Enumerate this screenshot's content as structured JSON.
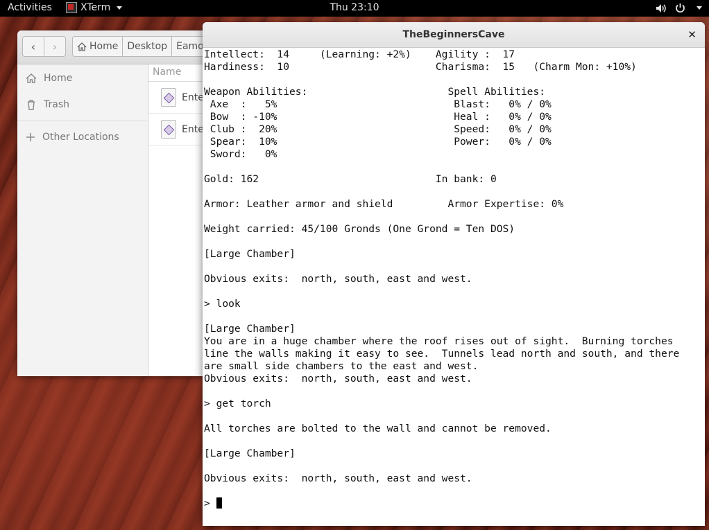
{
  "topbar": {
    "activities": "Activities",
    "app_name": "XTerm",
    "clock": "Thu 23:10"
  },
  "files": {
    "breadcrumbs": [
      "Home",
      "Desktop",
      "Eamon"
    ],
    "sidebar": [
      {
        "label": "Home",
        "icon": "home-icon"
      },
      {
        "label": "Trash",
        "icon": "trash-icon"
      },
      {
        "label": "Other Locations",
        "icon": "plus-icon"
      }
    ],
    "column_name": "Name",
    "rows": [
      {
        "label": "Ente"
      },
      {
        "label": "Ente"
      }
    ]
  },
  "terminal": {
    "title": "TheBeginnersCave",
    "lines": [
      "Intellect:  14     (Learning: +2%)    Agility :  17",
      "Hardiness:  10                        Charisma:  15   (Charm Mon: +10%)",
      "",
      "Weapon Abilities:                       Spell Abilities:",
      " Axe  :   5%                             Blast:   0% / 0%",
      " Bow  : -10%                             Heal :   0% / 0%",
      " Club :  20%                             Speed:   0% / 0%",
      " Spear:  10%                             Power:   0% / 0%",
      " Sword:   0%",
      "",
      "Gold: 162                             In bank: 0",
      "",
      "Armor: Leather armor and shield         Armor Expertise: 0%",
      "",
      "Weight carried: 45/100 Gronds (One Grond = Ten DOS)",
      "",
      "[Large Chamber]",
      "",
      "Obvious exits:  north, south, east and west.",
      "",
      "> look",
      "",
      "[Large Chamber]",
      "You are in a huge chamber where the roof rises out of sight.  Burning torches",
      "line the walls making it easy to see.  Tunnels lead north and south, and there",
      "are small side chambers to the east and west.",
      "Obvious exits:  north, south, east and west.",
      "",
      "> get torch",
      "",
      "All torches are bolted to the wall and cannot be removed.",
      "",
      "[Large Chamber]",
      "",
      "Obvious exits:  north, south, east and west.",
      ""
    ],
    "prompt": "> "
  }
}
